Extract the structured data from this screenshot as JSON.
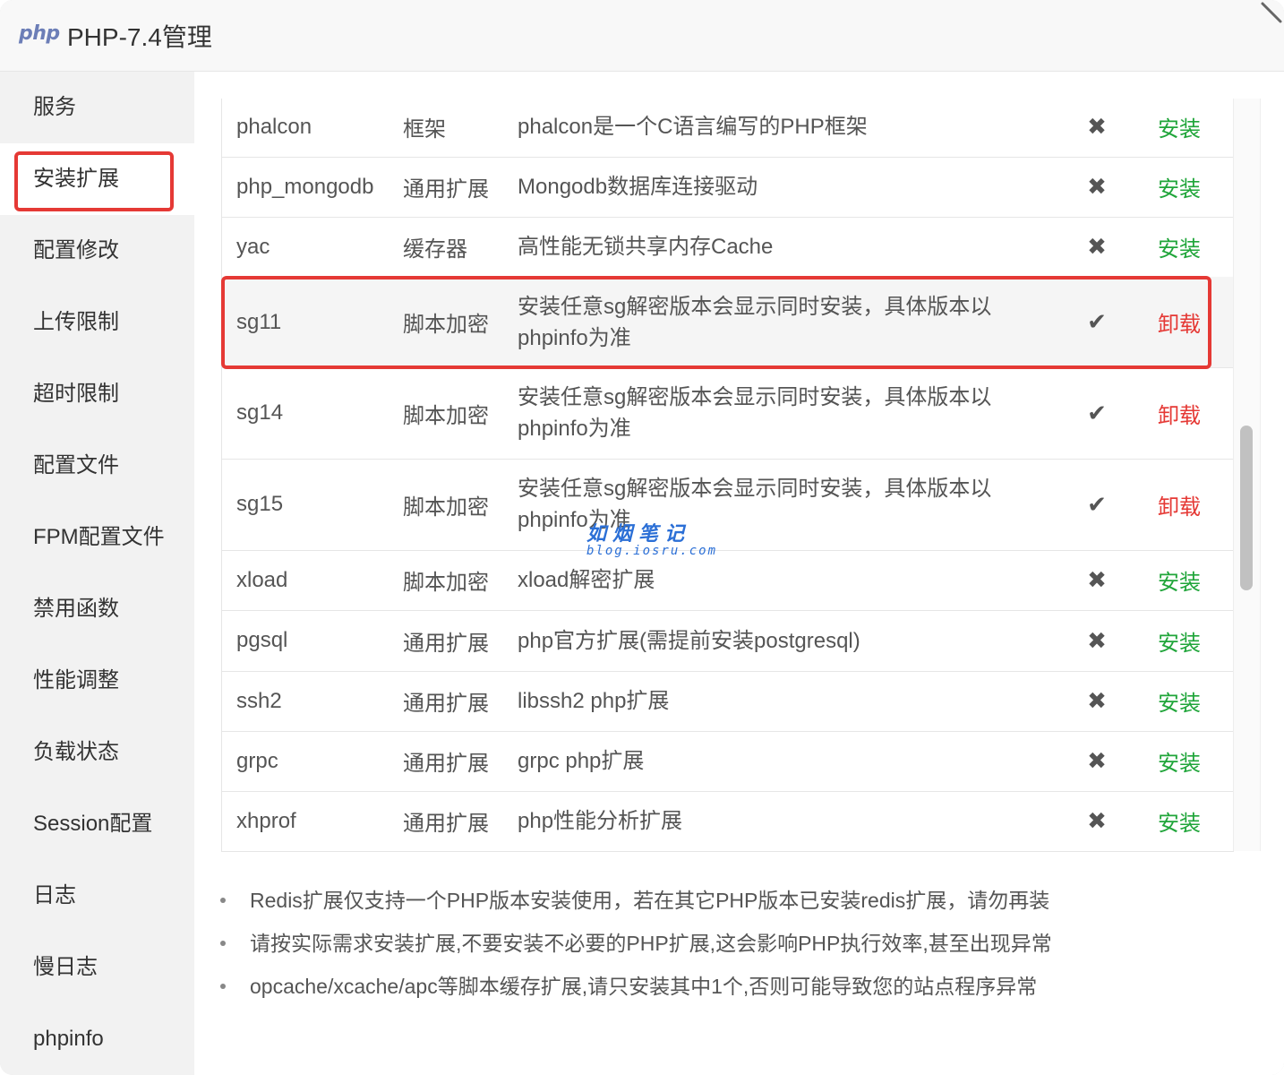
{
  "window": {
    "logo_text": "php",
    "title": "PHP-7.4管理"
  },
  "sidebar": {
    "items": [
      {
        "label": "服务"
      },
      {
        "label": "安装扩展"
      },
      {
        "label": "配置修改"
      },
      {
        "label": "上传限制"
      },
      {
        "label": "超时限制"
      },
      {
        "label": "配置文件"
      },
      {
        "label": "FPM配置文件"
      },
      {
        "label": "禁用函数"
      },
      {
        "label": "性能调整"
      },
      {
        "label": "负载状态"
      },
      {
        "label": "Session配置"
      },
      {
        "label": "日志"
      },
      {
        "label": "慢日志"
      },
      {
        "label": "phpinfo"
      }
    ],
    "active_index": 1
  },
  "extensions": {
    "rows": [
      {
        "name": "phalcon",
        "type": "框架",
        "desc": "phalcon是一个C语言编写的PHP框架",
        "status_icon": "cross-icon",
        "status": "✖",
        "op": "安装"
      },
      {
        "name": "php_mongodb",
        "type": "通用扩展",
        "desc": "Mongodb数据库连接驱动",
        "status_icon": "cross-icon",
        "status": "✖",
        "op": "安装"
      },
      {
        "name": "yac",
        "type": "缓存器",
        "desc": "高性能无锁共享内存Cache",
        "status_icon": "cross-icon",
        "status": "✖",
        "op": "安装"
      },
      {
        "name": "sg11",
        "type": "脚本加密",
        "desc": "安装任意sg解密版本会显示同时安装，具体版本以phpinfo为准",
        "status_icon": "check-icon",
        "status": "✔",
        "op": "卸载"
      },
      {
        "name": "sg14",
        "type": "脚本加密",
        "desc": "安装任意sg解密版本会显示同时安装，具体版本以phpinfo为准",
        "status_icon": "check-icon",
        "status": "✔",
        "op": "卸载"
      },
      {
        "name": "sg15",
        "type": "脚本加密",
        "desc": "安装任意sg解密版本会显示同时安装，具体版本以phpinfo为准",
        "status_icon": "check-icon",
        "status": "✔",
        "op": "卸载"
      },
      {
        "name": "xload",
        "type": "脚本加密",
        "desc": "xload解密扩展",
        "status_icon": "cross-icon",
        "status": "✖",
        "op": "安装"
      },
      {
        "name": "pgsql",
        "type": "通用扩展",
        "desc": "php官方扩展(需提前安装postgresql)",
        "status_icon": "cross-icon",
        "status": "✖",
        "op": "安装"
      },
      {
        "name": "ssh2",
        "type": "通用扩展",
        "desc": "libssh2 php扩展",
        "status_icon": "cross-icon",
        "status": "✖",
        "op": "安装"
      },
      {
        "name": "grpc",
        "type": "通用扩展",
        "desc": "grpc php扩展",
        "status_icon": "cross-icon",
        "status": "✖",
        "op": "安装"
      },
      {
        "name": "xhprof",
        "type": "通用扩展",
        "desc": "php性能分析扩展",
        "status_icon": "cross-icon",
        "status": "✖",
        "op": "安装"
      }
    ]
  },
  "tips": [
    "Redis扩展仅支持一个PHP版本安装使用，若在其它PHP版本已安装redis扩展，请勿再装",
    "请按实际需求安装扩展,不要安装不必要的PHP扩展,这会影响PHP执行效率,甚至出现异常",
    "opcache/xcache/apc等脚本缓存扩展,请只安装其中1个,否则可能导致您的站点程序异常"
  ],
  "watermark": {
    "main": "如烟笔记",
    "sub": "blog.iosru.com"
  },
  "colors": {
    "install": "#20a53a",
    "uninstall": "#e53935",
    "highlight": "#e53935"
  }
}
